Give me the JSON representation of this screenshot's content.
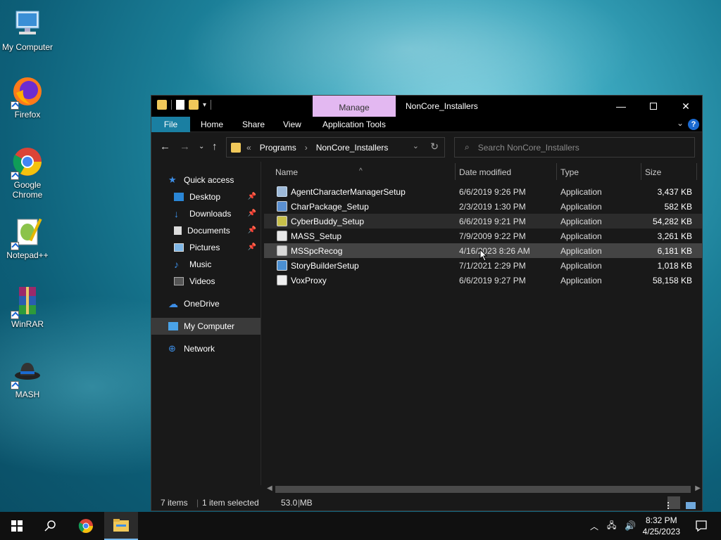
{
  "desktop": {
    "icons": [
      {
        "label": "My Computer"
      },
      {
        "label": "Firefox"
      },
      {
        "label": "Google Chrome"
      },
      {
        "label": "Notepad++"
      },
      {
        "label": "WinRAR"
      },
      {
        "label": "MASH"
      }
    ]
  },
  "window": {
    "title": "NonCore_Installers",
    "manage_tab": "Manage",
    "ribbon_tabs": [
      "File",
      "Home",
      "Share",
      "View",
      "Application Tools"
    ],
    "address": {
      "crumb_prefix": "«",
      "crumbs": [
        "Programs",
        "NonCore_Installers"
      ]
    },
    "search_placeholder": "Search NonCore_Installers",
    "nav": {
      "quick_access": "Quick access",
      "items": [
        {
          "label": "Desktop",
          "pinned": true
        },
        {
          "label": "Downloads",
          "pinned": true
        },
        {
          "label": "Documents",
          "pinned": true
        },
        {
          "label": "Pictures",
          "pinned": true
        },
        {
          "label": "Music",
          "pinned": false
        },
        {
          "label": "Videos",
          "pinned": false
        }
      ],
      "onedrive": "OneDrive",
      "my_computer": "My Computer",
      "network": "Network"
    },
    "columns": {
      "name": "Name",
      "date": "Date modified",
      "type": "Type",
      "size": "Size"
    },
    "files": [
      {
        "name": "AgentCharacterManagerSetup",
        "date": "6/6/2019 9:26 PM",
        "type": "Application",
        "size": "3,437 KB"
      },
      {
        "name": "CharPackage_Setup",
        "date": "2/3/2019 1:30 PM",
        "type": "Application",
        "size": "582 KB"
      },
      {
        "name": "CyberBuddy_Setup",
        "date": "6/6/2019 9:21 PM",
        "type": "Application",
        "size": "54,282 KB"
      },
      {
        "name": "MASS_Setup",
        "date": "7/9/2009 9:22 PM",
        "type": "Application",
        "size": "3,261 KB"
      },
      {
        "name": "MSSpcRecog",
        "date": "4/16/2023 8:26 AM",
        "type": "Application",
        "size": "6,181 KB"
      },
      {
        "name": "StoryBuilderSetup",
        "date": "7/1/2021 2:29 PM",
        "type": "Application",
        "size": "1,018 KB"
      },
      {
        "name": "VoxProxy",
        "date": "6/6/2019 9:27 PM",
        "type": "Application",
        "size": "58,158 KB"
      }
    ],
    "status": {
      "items": "7 items",
      "selected": "1 item selected",
      "size": "53.0 MB"
    }
  },
  "taskbar": {
    "time": "8:32 PM",
    "date": "4/25/2023"
  },
  "colors": {
    "accent": "#1a7fa2",
    "manage_tab": "#e3b8f1",
    "folder": "#f0c85a"
  }
}
